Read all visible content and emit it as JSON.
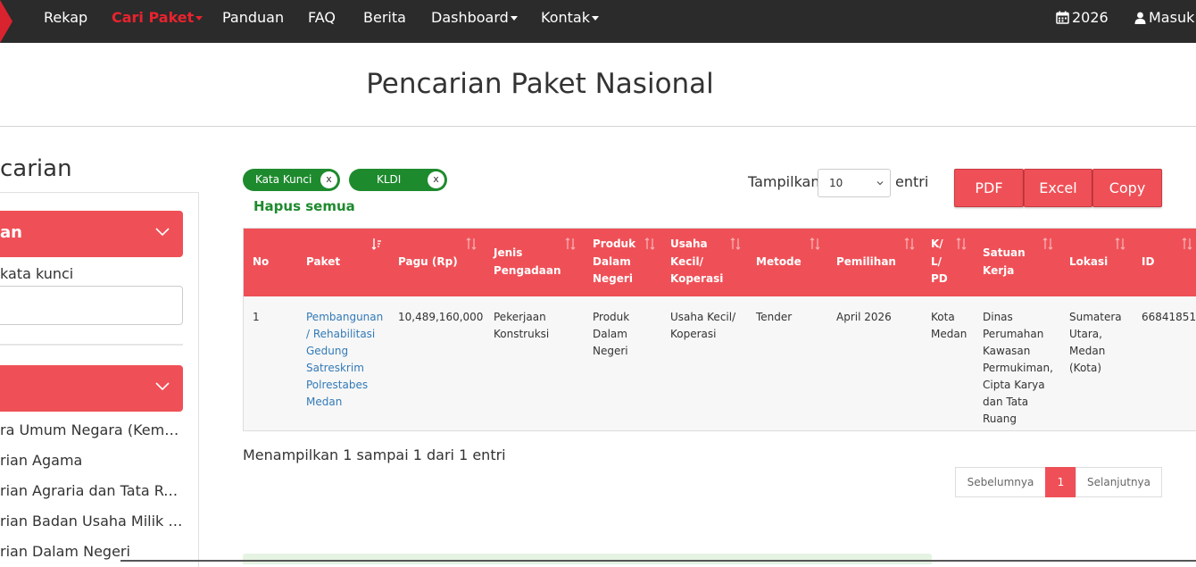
{
  "nav": {
    "items": [
      {
        "label": "Rekap",
        "caret": false,
        "active": false
      },
      {
        "label": "Cari Paket",
        "caret": true,
        "active": true
      },
      {
        "label": "Panduan",
        "caret": false,
        "active": false
      },
      {
        "label": "FAQ",
        "caret": false,
        "active": false
      },
      {
        "label": "Berita",
        "caret": false,
        "active": false
      },
      {
        "label": "Dashboard",
        "caret": true,
        "active": false
      },
      {
        "label": "Kontak",
        "caret": true,
        "active": false
      }
    ],
    "year_label": "2026",
    "login_label": "Masuk",
    "accent_color": "#e8232e"
  },
  "page": {
    "title": "Pencarian Paket Nasional"
  },
  "sidebar": {
    "heading": "carian",
    "keyword_section_label": "an",
    "keyword_field_label": "kata kunci",
    "keyword_value": "",
    "kldi_section_label": "",
    "kldi_items": [
      "ra Umum Negara (Kemen...",
      "rian Agama",
      "rian Agraria dan Tata Rua...",
      "rian Badan Usaha Milik N...",
      "rian Dalam Negeri"
    ]
  },
  "filters": {
    "chips": [
      {
        "label": "Kata Kunci",
        "remove": "x"
      },
      {
        "label": "KLDI",
        "remove": "x"
      }
    ],
    "clear_all_label": "Hapus semua",
    "chip_color": "#1e8a2e"
  },
  "controls": {
    "show_label": "Tampilkan",
    "page_size": "10",
    "entries_label": "entri",
    "export_buttons": [
      "PDF",
      "Excel",
      "Copy"
    ]
  },
  "table": {
    "header_color": "#ef5057",
    "columns": [
      {
        "key": "no",
        "label": "No"
      },
      {
        "key": "paket",
        "label": "Paket"
      },
      {
        "key": "pagu",
        "label": "Pagu (Rp)"
      },
      {
        "key": "jenis",
        "label": "Jenis Pengadaan"
      },
      {
        "key": "produk",
        "label": "Produk Dalam Negeri"
      },
      {
        "key": "usaha",
        "label": "Usaha Kecil/ Koperasi"
      },
      {
        "key": "metode",
        "label": "Metode"
      },
      {
        "key": "pemilihan",
        "label": "Pemilihan"
      },
      {
        "key": "klpd",
        "label": "K/ L/ PD"
      },
      {
        "key": "satker",
        "label": "Satuan Kerja"
      },
      {
        "key": "lokasi",
        "label": "Lokasi"
      },
      {
        "key": "id",
        "label": "ID"
      }
    ],
    "rows": [
      {
        "no": "1",
        "paket": "Pembangunan / Rehabilitasi Gedung Satreskrim Polrestabes Medan",
        "pagu": "10,489,160,000",
        "jenis": "Pekerjaan Konstruksi",
        "produk": "Produk Dalam Negeri",
        "usaha": "Usaha Kecil/ Koperasi",
        "metode": "Tender",
        "pemilihan": "April 2026",
        "klpd": "Kota Medan",
        "satker": "Dinas Perumahan Kawasan Permukiman, Cipta Karya dan Tata Ruang",
        "lokasi": "Sumatera Utara, Medan (Kota)",
        "id": "66841851"
      }
    ]
  },
  "footer": {
    "info_text": "Menampilkan 1 sampai 1 dari 1 entri",
    "prev_label": "Sebelumnya",
    "current_page": "1",
    "next_label": "Selanjutnya"
  }
}
